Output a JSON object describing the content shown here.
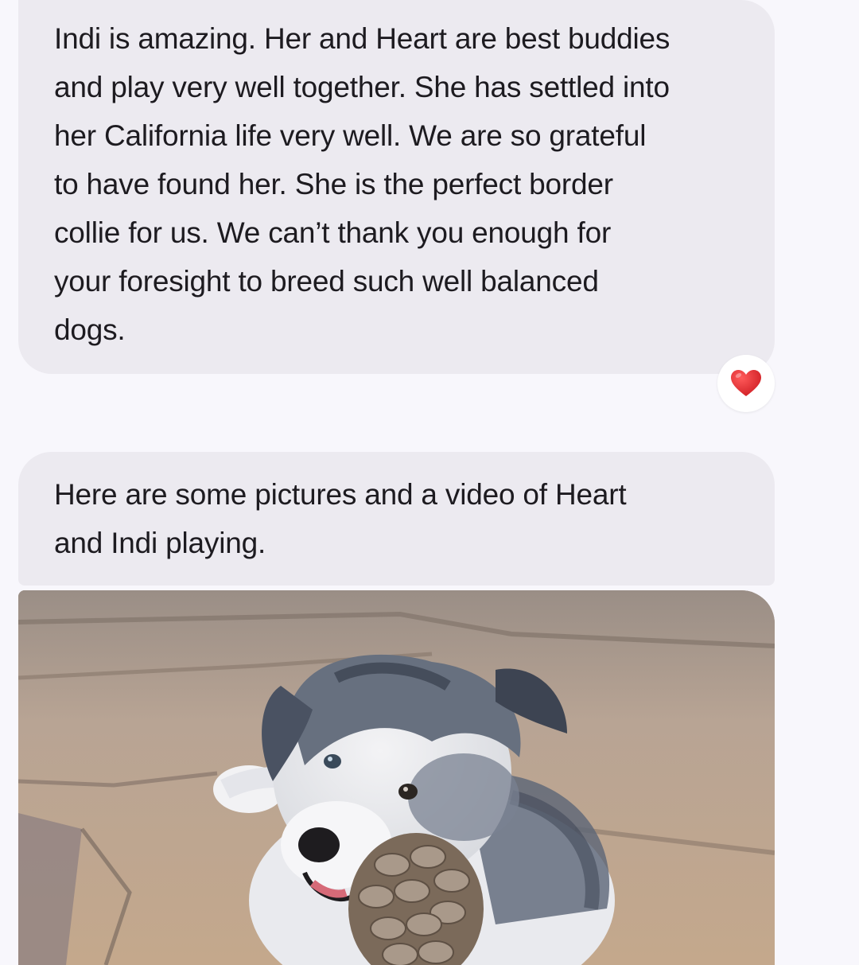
{
  "messages": [
    {
      "lines": [
        "Indi is amazing. Her and Heart are best buddies",
        "and play very well together. She has settled into",
        "her California life very well. We are so grateful",
        "to have found her. She is the perfect border",
        "collie for us. We can’t thank you enough for",
        "your foresight to breed such well balanced",
        "dogs."
      ],
      "reaction": "heart-reaction"
    },
    {
      "lines": [
        "Here are some pictures and a video of Heart",
        "and Indi playing."
      ]
    }
  ],
  "attachment": {
    "type": "photo",
    "icon": "puppy-photo"
  },
  "colors": {
    "background": "#f8f7fc",
    "bubble": "#eceaf0",
    "text": "#1d1b20",
    "heart": "#e0262b"
  }
}
